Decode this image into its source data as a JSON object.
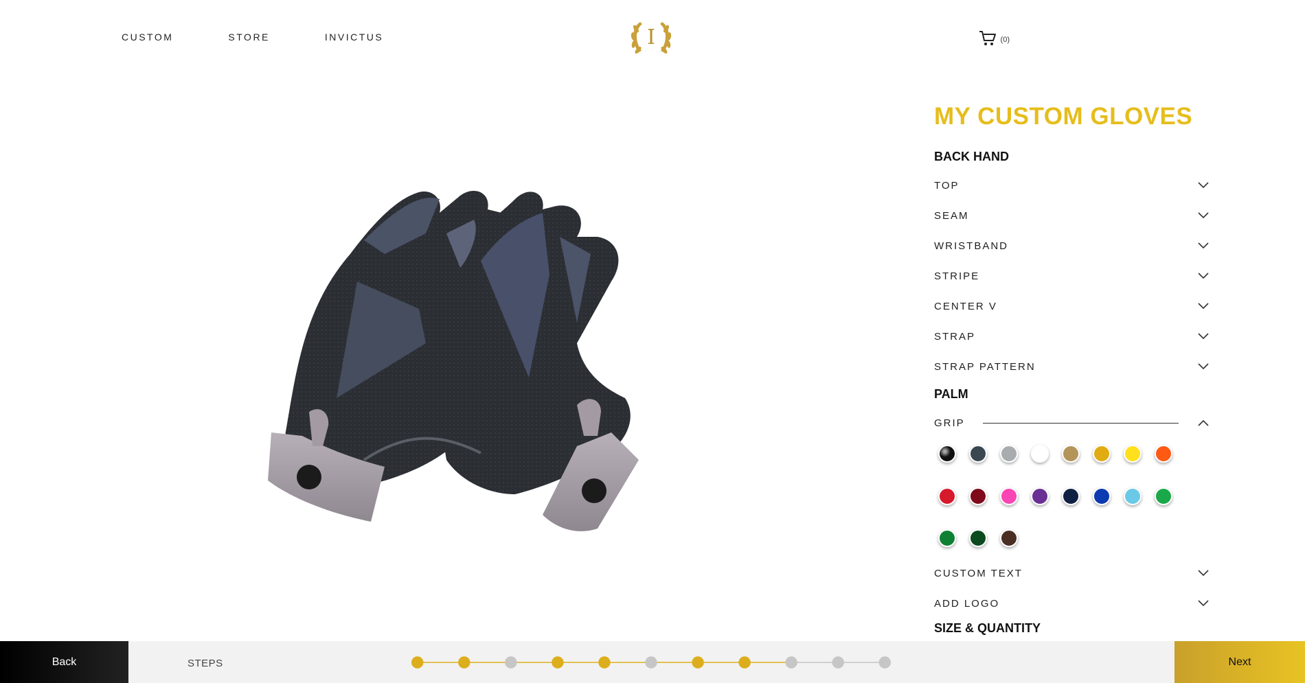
{
  "nav": {
    "items": [
      "CUSTOM",
      "STORE",
      "INVICTUS"
    ]
  },
  "logo": {
    "letter": "I"
  },
  "cart": {
    "count": "(0)"
  },
  "panel": {
    "title": "MY CUSTOM GLOVES",
    "back_hand": {
      "title": "BACK HAND",
      "options": [
        "TOP",
        "SEAM",
        "WRISTBAND",
        "STRIPE",
        "CENTER V",
        "STRAP",
        "STRAP PATTERN"
      ]
    },
    "palm": {
      "title": "PALM",
      "grip_label": "GRIP",
      "grip_colors": [
        "#111111",
        "#3a4750",
        "#a8acae",
        "#ffffff",
        "#b3955a",
        "#e1ab12",
        "#ffe01d",
        "#fe5a14",
        "#d6192b",
        "#7e0a1c",
        "#fb45b4",
        "#6a2f94",
        "#0f2143",
        "#0c3ab0",
        "#6ac9e6",
        "#1aa94a",
        "#0e8034",
        "#0a4a1e",
        "#4a2e24"
      ],
      "more_options": [
        "CUSTOM TEXT",
        "ADD LOGO"
      ]
    },
    "next_section": "SIZE & QUANTITY"
  },
  "bottom": {
    "back_label": "Back",
    "steps_label": "STEPS",
    "steps_state": [
      "done",
      "done",
      "todo",
      "done",
      "done",
      "todo",
      "done",
      "done",
      "todo",
      "todo",
      "todo"
    ],
    "next_label": "Next"
  },
  "colors": {
    "accent": "#e6bd1c",
    "step_done": "#dcae1d",
    "step_todo": "#c6c6c6"
  }
}
